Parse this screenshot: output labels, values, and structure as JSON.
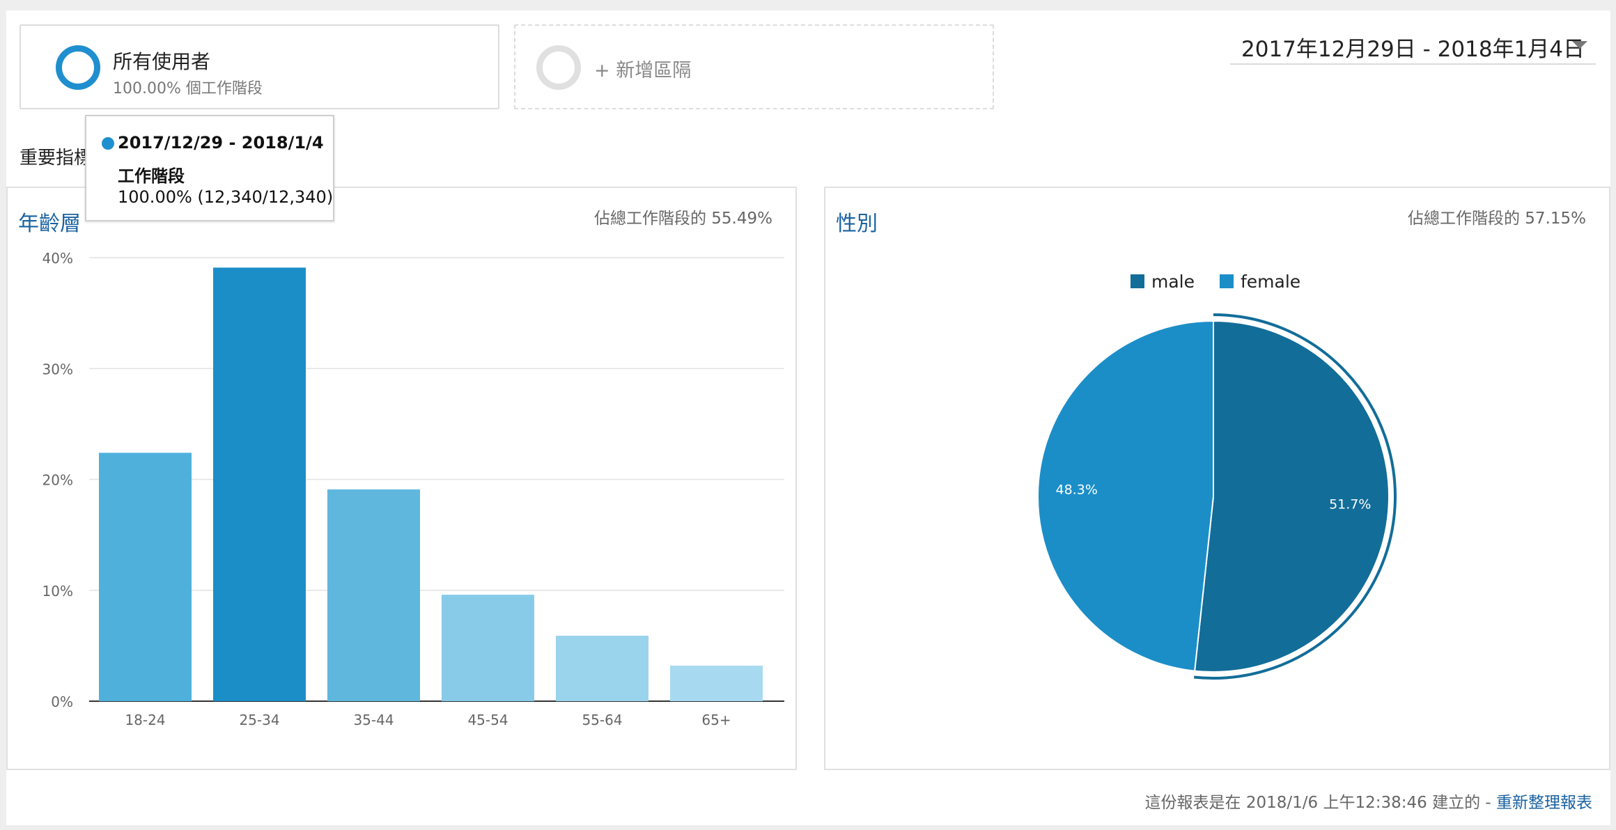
{
  "segments": {
    "all_users_title": "所有使用者",
    "all_users_sub": "100.00% 個工作階段",
    "add_label": "+ 新增區隔"
  },
  "date_range": "2017年12月29日 - 2018年1月4日",
  "section_title": "重要指標",
  "tooltip": {
    "range": "2017/12/29 - 2018/1/4",
    "metric": "工作階段",
    "value": "100.00% (12,340/12,340)"
  },
  "age_panel": {
    "title": "年齡層",
    "note": "佔總工作階段的 55.49%"
  },
  "gender_panel": {
    "title": "性別",
    "note": "佔總工作階段的 57.15%"
  },
  "chart_data": [
    {
      "type": "bar",
      "title": "年齡層",
      "categories": [
        "18-24",
        "25-34",
        "35-44",
        "45-54",
        "55-64",
        "65+"
      ],
      "values": [
        22.4,
        39.1,
        19.1,
        9.6,
        5.9,
        3.2
      ],
      "ylim": [
        0,
        40
      ],
      "yticks": [
        "0%",
        "10%",
        "20%",
        "30%",
        "40%"
      ],
      "grid": true,
      "colors": [
        "#4fb0dc",
        "#1b8ec8",
        "#5fb7de",
        "#87cbe8",
        "#99d3ec",
        "#a7daf0"
      ]
    },
    {
      "type": "pie",
      "title": "性別",
      "labels": [
        "male",
        "female"
      ],
      "values": [
        51.7,
        48.3
      ],
      "value_labels": [
        "51.7%",
        "48.3%"
      ],
      "colors": [
        "#126d99",
        "#1b8ec8"
      ],
      "legend": "top"
    }
  ],
  "footer": {
    "text": "這份報表是在 2018/1/6 上午12:38:46 建立的 - ",
    "link": "重新整理報表"
  }
}
